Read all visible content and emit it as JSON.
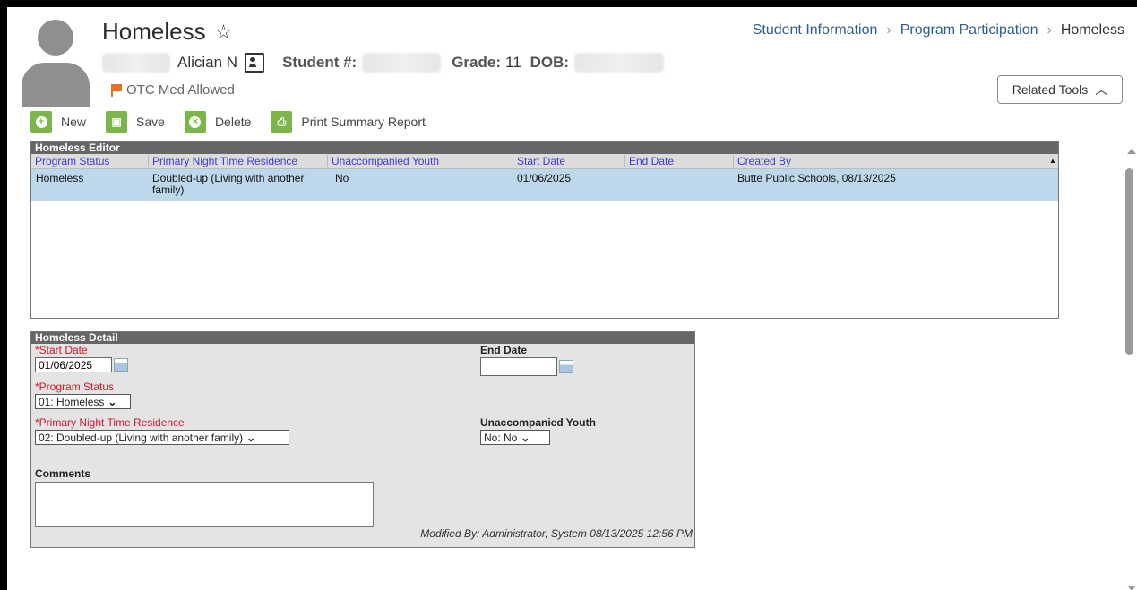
{
  "header": {
    "title": "Homeless",
    "star_icon": "star-outline-icon",
    "breadcrumb": [
      "Student Information",
      "Program Participation",
      "Homeless"
    ],
    "student": {
      "name": "Alician N",
      "student_number_label": "Student #:",
      "grade_label": "Grade:",
      "grade_value": "11",
      "dob_label": "DOB:"
    },
    "flag_text": "OTC Med Allowed",
    "related_tools": "Related Tools"
  },
  "toolbar": {
    "new": "New",
    "save": "Save",
    "delete": "Delete",
    "print": "Print Summary Report"
  },
  "editor": {
    "title": "Homeless Editor",
    "columns": [
      "Program Status",
      "Primary Night Time Residence",
      "Unaccompanied Youth",
      "Start Date",
      "End Date",
      "Created By"
    ],
    "rows": [
      {
        "program_status": "Homeless",
        "residence": "Doubled-up (Living with another family)",
        "unaccompanied": "No",
        "start": "01/06/2025",
        "end": "",
        "created_by": "Butte Public Schools, 08/13/2025"
      }
    ]
  },
  "detail": {
    "title": "Homeless Detail",
    "start_date_label": "*Start Date",
    "start_date_value": "01/06/2025",
    "end_date_label": "End Date",
    "end_date_value": "",
    "program_status_label": "*Program Status",
    "program_status_value": "01: Homeless",
    "residence_label": "*Primary Night Time Residence",
    "residence_value": "02: Doubled-up (Living with another family)",
    "unaccompanied_label": "Unaccompanied Youth",
    "unaccompanied_value": "No: No",
    "comments_label": "Comments",
    "modified_by": "Modified By: Administrator, System 08/13/2025 12:56 PM"
  },
  "colors": {
    "accent_green": "#7ab648",
    "link_blue": "#2f5d8f",
    "required_red": "#d3152a",
    "selected_row": "#bcd8ea",
    "flag_orange": "#e8701f"
  }
}
